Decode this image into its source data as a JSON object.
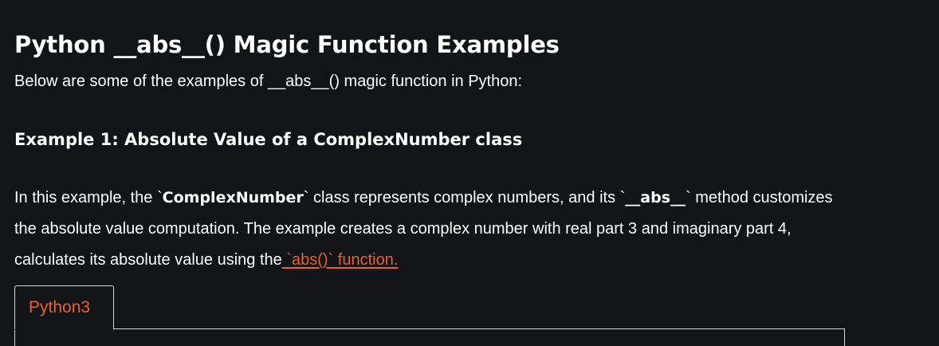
{
  "article": {
    "title": "Python __abs__() Magic Function Examples",
    "intro": "Below are some of the examples of __abs__() magic function in Python:",
    "example1": {
      "heading": "Example 1: Absolute Value of a ComplexNumber class",
      "desc_part1": "In this example, the `",
      "desc_bold1": "ComplexNumber",
      "desc_part2": "` class represents complex numbers, and its `",
      "desc_bold2": "__abs__",
      "desc_part3": "` method customizes the absolute value computation. The example creates a complex number with real part 3 and imaginary part 4, calculates its absolute value using the",
      "desc_link": " `abs()` function."
    }
  },
  "code_tabs": [
    {
      "label": "Python3",
      "active": true
    }
  ],
  "colors": {
    "background": "#131417",
    "text": "#ffffff",
    "accent": "#e8622b",
    "border": "#d8d8d8"
  }
}
